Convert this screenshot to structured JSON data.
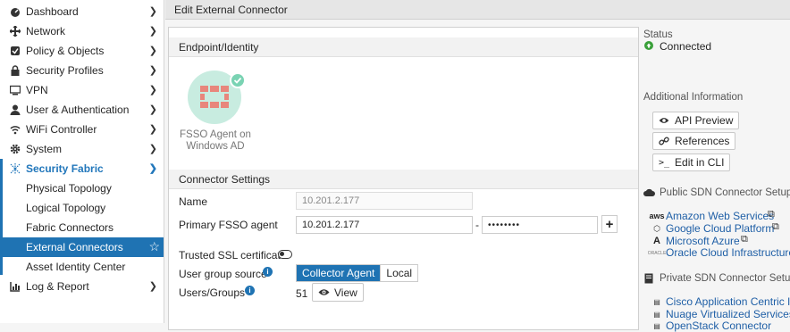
{
  "sidebar": {
    "items": [
      {
        "label": "Dashboard",
        "icon": "dashboard-icon"
      },
      {
        "label": "Network",
        "icon": "network-icon"
      },
      {
        "label": "Policy & Objects",
        "icon": "policy-icon"
      },
      {
        "label": "Security Profiles",
        "icon": "lock-icon"
      },
      {
        "label": "VPN",
        "icon": "monitor-icon"
      },
      {
        "label": "User & Authentication",
        "icon": "user-icon"
      },
      {
        "label": "WiFi Controller",
        "icon": "wifi-icon"
      },
      {
        "label": "System",
        "icon": "gear-icon"
      },
      {
        "label": "Security Fabric",
        "icon": "fabric-icon"
      }
    ],
    "sub_items": [
      {
        "label": "Physical Topology"
      },
      {
        "label": "Logical Topology"
      },
      {
        "label": "Fabric Connectors"
      },
      {
        "label": "External Connectors"
      },
      {
        "label": "Asset Identity Center"
      }
    ],
    "last_item": {
      "label": "Log & Report",
      "icon": "report-icon"
    }
  },
  "header": {
    "title": "Edit External Connector"
  },
  "form": {
    "endpoint_section": "Endpoint/Identity",
    "connector_name_line1": "FSSO Agent on",
    "connector_name_line2": "Windows AD",
    "settings_section": "Connector Settings",
    "name_label": "Name",
    "name_placeholder": "10.201.2.177",
    "primary_label": "Primary FSSO agent",
    "primary_value": "10.201.2.177",
    "separator": "-",
    "password_value": "••••••••",
    "add_label": "+",
    "ssl_label": "Trusted SSL certificate",
    "group_source_label": "User group source",
    "group_source_options": [
      "Collector Agent",
      "Local"
    ],
    "users_groups_label": "Users/Groups",
    "users_groups_count": "51",
    "view_label": "View"
  },
  "status": {
    "label": "Status",
    "value": "Connected",
    "color": "#3aa03a"
  },
  "additional": {
    "title": "Additional Information",
    "buttons": [
      "API Preview",
      "References",
      "Edit in CLI"
    ]
  },
  "public_sdn": {
    "title": "Public SDN Connector Setup G",
    "links": [
      "Amazon Web Services",
      "Google Cloud Platform",
      "Microsoft Azure",
      "Oracle Cloud Infrastructure"
    ]
  },
  "private_sdn": {
    "title": "Private SDN Connector Setup G",
    "links": [
      "Cisco Application Centric Infr",
      "Nuage Virtualized Services Pl",
      "OpenStack Connector"
    ]
  },
  "colors": {
    "accent": "#1f73b3",
    "toggle_on": "#3aa03a"
  }
}
